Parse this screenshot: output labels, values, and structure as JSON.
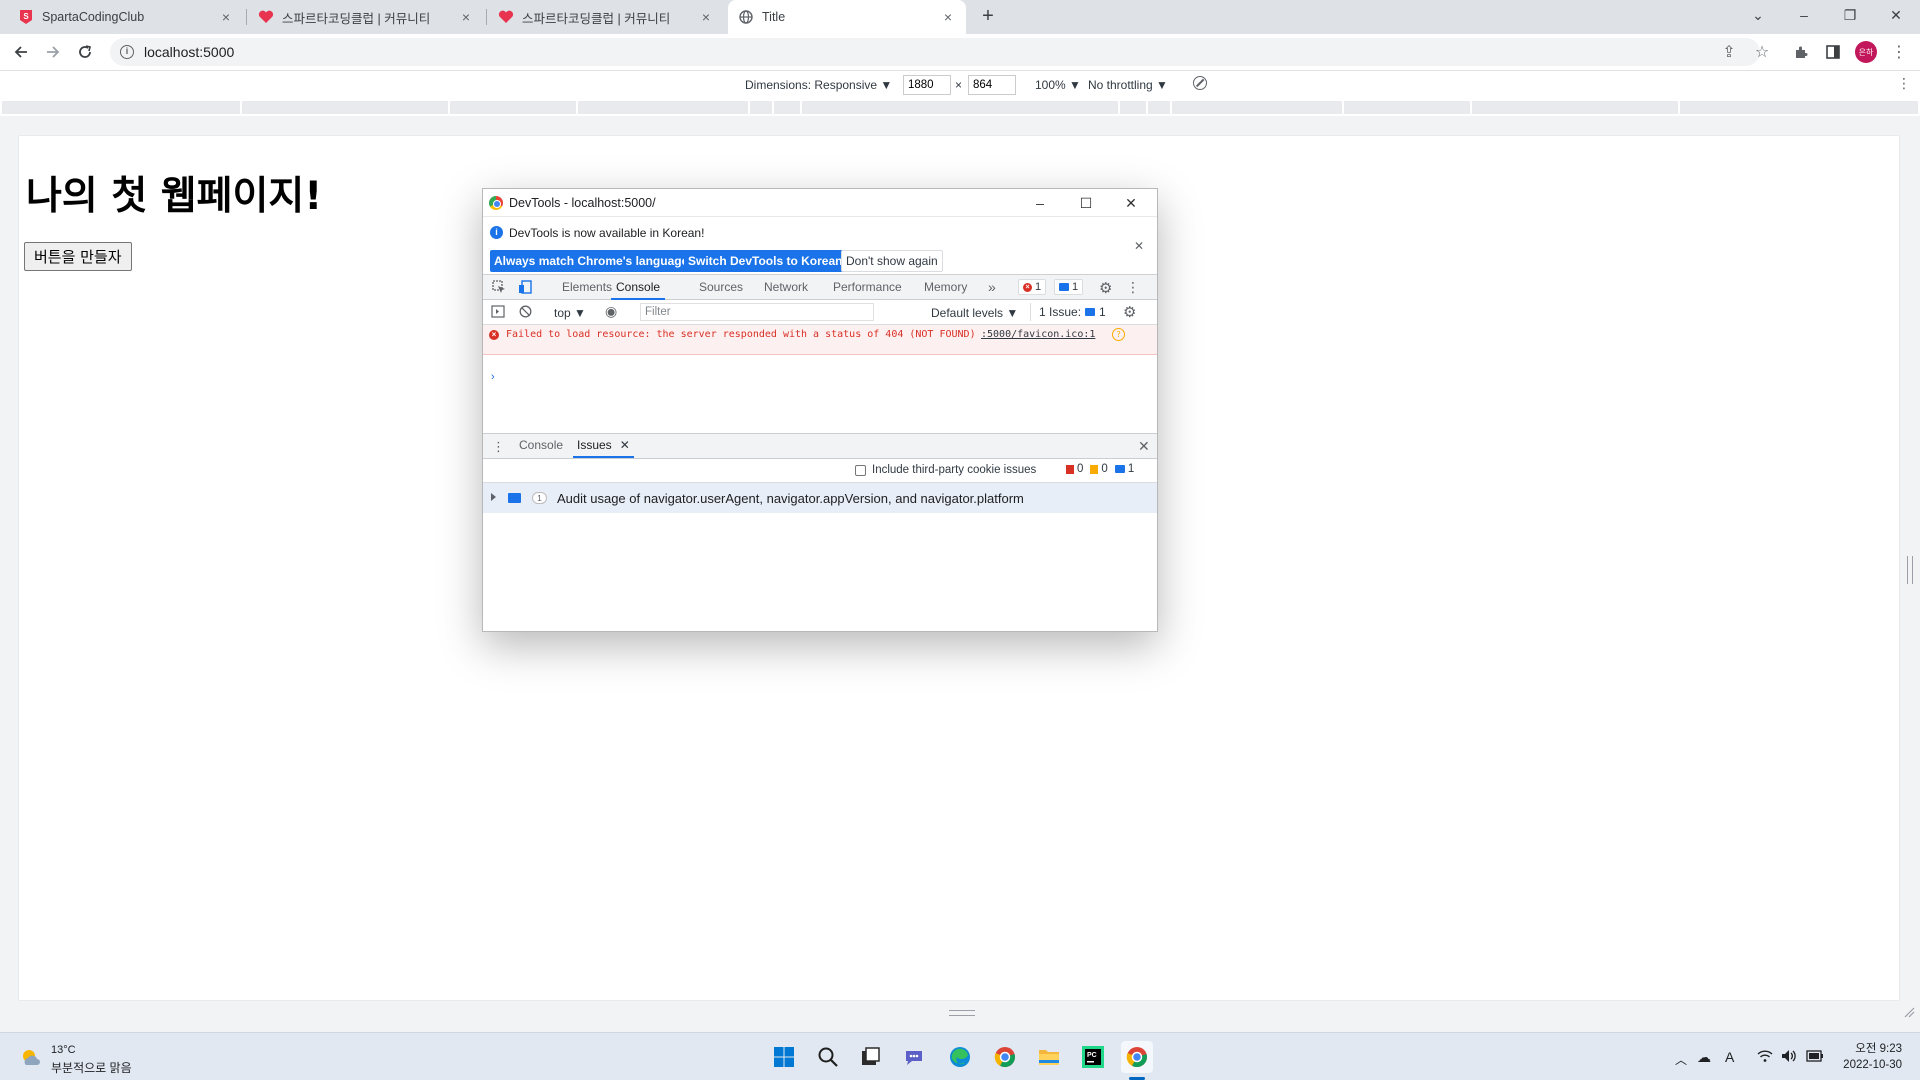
{
  "tabs": [
    {
      "title": "SpartaCodingClub",
      "favicon": "sparta-icon"
    },
    {
      "title": "스파르타코딩클럽 | 커뮤니티",
      "favicon": "heart-icon"
    },
    {
      "title": "스파르타코딩클럽 | 커뮤니티",
      "favicon": "heart-icon"
    },
    {
      "title": "Title",
      "favicon": "globe-icon",
      "active": true
    }
  ],
  "address": {
    "url": "localhost:5000"
  },
  "device_toolbar": {
    "dimensions_label": "Dimensions: Responsive ▼",
    "width": "1880",
    "times": "×",
    "height": "864",
    "zoom": "100% ▼",
    "throttling": "No throttling ▼"
  },
  "page": {
    "heading": "나의 첫 웹페이지!",
    "button_label": "버튼을 만들자"
  },
  "devtools": {
    "window_title": "DevTools - localhost:5000/",
    "infobar": {
      "message": "DevTools is now available in Korean!",
      "btn_match": "Always match Chrome's language",
      "btn_switch": "Switch DevTools to Korean",
      "btn_dismiss": "Don't show again"
    },
    "tabs": [
      "Elements",
      "Console",
      "Sources",
      "Network",
      "Performance",
      "Memory"
    ],
    "more_tabs": "»",
    "error_count": "1",
    "message_count": "1",
    "console_toolbar": {
      "context": "top ▼",
      "filter_placeholder": "Filter",
      "levels": "Default levels ▼",
      "issues_label": "1 Issue:",
      "issues_count": "1"
    },
    "error": {
      "text": "Failed to load resource: the server responded with a status of 404 (NOT FOUND)",
      "source": ":5000/favicon.ico:1"
    },
    "prompt": "›",
    "drawer": {
      "tabs": [
        "Console",
        "Issues"
      ],
      "third_party_label": "Include third-party cookie issues",
      "errors": "0",
      "warnings": "0",
      "infos": "1",
      "issue": {
        "count": "1",
        "text": "Audit usage of navigator.userAgent, navigator.appVersion, and navigator.platform"
      }
    }
  },
  "taskbar": {
    "temperature": "13°C",
    "weather": "부분적으로 맑음",
    "apps": [
      "windows-start-icon",
      "search-icon",
      "file-explorer-task-icon",
      "teams-icon",
      "edge-icon",
      "chrome-icon",
      "folder-icon",
      "pycharm-icon",
      "chrome-icon"
    ],
    "ime": "A",
    "time_period": "오전 9:23",
    "date": "2022-10-30"
  },
  "colors": {
    "accent": "#1a73e8",
    "error": "#d93025",
    "tabstrip": "#dee1e6",
    "taskbar": "#e1e8f1"
  }
}
